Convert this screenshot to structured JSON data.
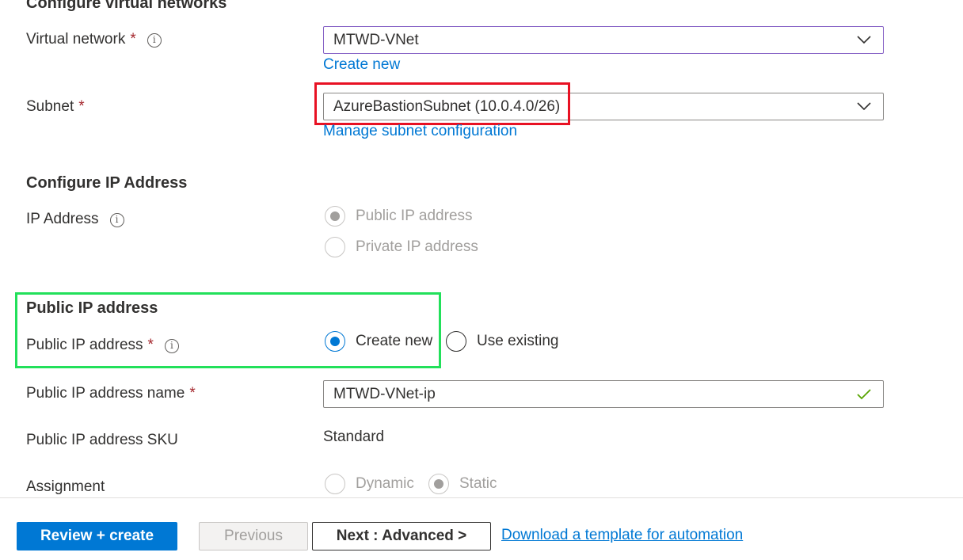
{
  "sections": {
    "vnet": {
      "title": "Configure virtual networks"
    },
    "ip": {
      "title": "Configure IP Address"
    },
    "public_ip": {
      "title": "Public IP address"
    }
  },
  "fields": {
    "virtual_network": {
      "label": "Virtual network",
      "required": "*",
      "value": "MTWD-VNet",
      "link": "Create new"
    },
    "subnet": {
      "label": "Subnet",
      "required": "*",
      "value": "AzureBastionSubnet (10.0.4.0/26)",
      "link": "Manage subnet configuration"
    },
    "ip_address": {
      "label": "IP Address",
      "options": [
        "Public IP address",
        "Private IP address"
      ],
      "selected": "Public IP address"
    },
    "public_ip_address": {
      "label": "Public IP address",
      "required": "*",
      "options": [
        "Create new",
        "Use existing"
      ],
      "selected": "Create new"
    },
    "public_ip_name": {
      "label": "Public IP address name",
      "required": "*",
      "value": "MTWD-VNet-ip"
    },
    "public_ip_sku": {
      "label": "Public IP address SKU",
      "value": "Standard"
    },
    "assignment": {
      "label": "Assignment",
      "options": [
        "Dynamic",
        "Static"
      ],
      "selected": "Static"
    }
  },
  "footer": {
    "review_create": "Review + create",
    "previous": "Previous",
    "next": "Next : Advanced >",
    "download": "Download a template for automation"
  },
  "icons": {
    "info": "info-icon",
    "chevron": "chevron-down-icon",
    "check": "checkmark-icon"
  },
  "colors": {
    "primary": "#0078d4",
    "required": "#a4262c",
    "highlight_red": "#e81123",
    "highlight_green": "#22e05a",
    "valid": "#57a300"
  }
}
